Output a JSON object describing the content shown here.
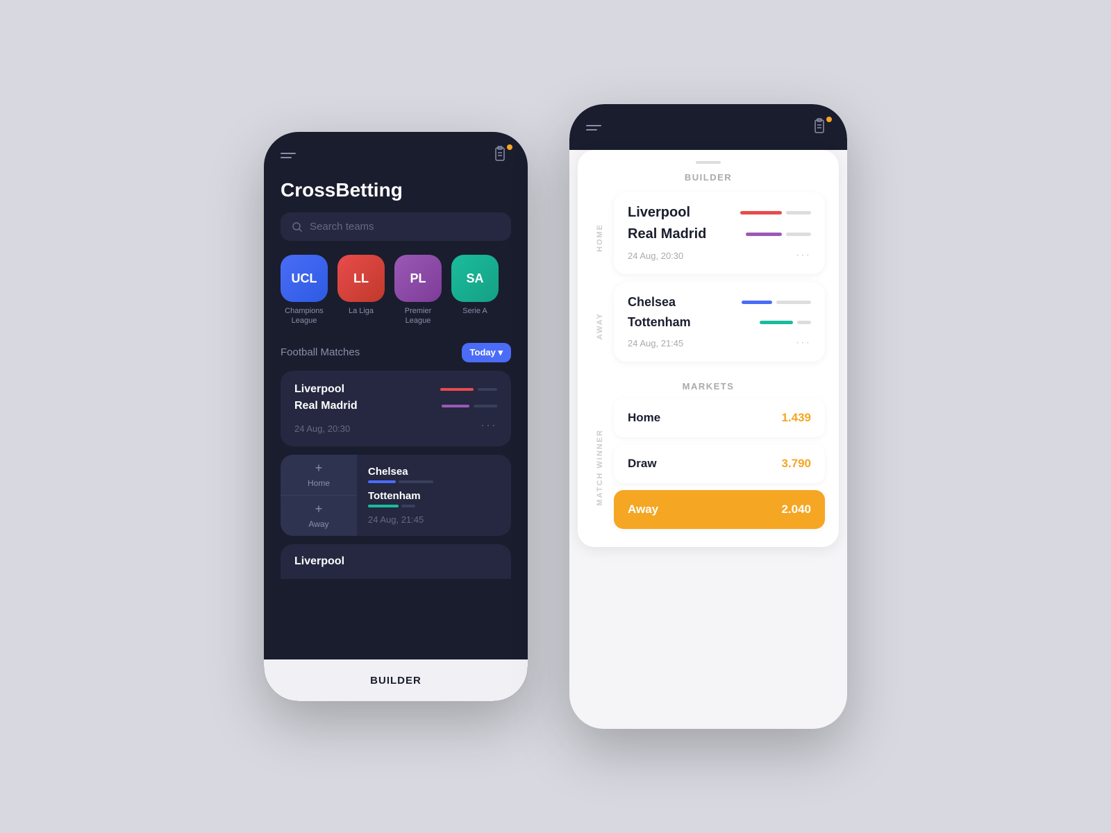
{
  "app": {
    "name": "CrossBetting",
    "builder_label": "BUILDER"
  },
  "left_phone": {
    "search_placeholder": "Search teams",
    "leagues": [
      {
        "abbr": "UCL",
        "name": "Champions\nLeague",
        "style": "ucl"
      },
      {
        "abbr": "LL",
        "name": "La Liga",
        "style": "ll"
      },
      {
        "abbr": "PL",
        "name": "Premier\nLeague",
        "style": "pl"
      },
      {
        "abbr": "SA",
        "name": "Serie A",
        "style": "sa"
      }
    ],
    "section_title": "Football Matches",
    "today_btn": "Today ▾",
    "match1": {
      "team1": "Liverpool",
      "team2": "Real Madrid",
      "time": "24 Aug, 20:30"
    },
    "match2": {
      "team1": "Chelsea",
      "team2": "Tottenham",
      "time": "24 Aug, 21:45",
      "btn1": "Home",
      "btn2": "Away"
    },
    "match3_partial": "Liverpool"
  },
  "right_phone": {
    "builder_title": "BUILDER",
    "match1": {
      "team1": "Liverpool",
      "team2": "Real Madrid",
      "time": "24 Aug, 20:30"
    },
    "side_home": "HOME",
    "side_away": "AWAY",
    "match2": {
      "team1": "Chelsea",
      "team2": "Tottenham",
      "time": "24 Aug, 21:45"
    },
    "markets_title": "MARKETS",
    "match_winner_label": "MATCH WINNER",
    "markets": [
      {
        "name": "Home",
        "odds": "1.439",
        "selected": false
      },
      {
        "name": "Draw",
        "odds": "3.790",
        "selected": false
      },
      {
        "name": "Away",
        "odds": "2.040",
        "selected": true
      }
    ]
  }
}
